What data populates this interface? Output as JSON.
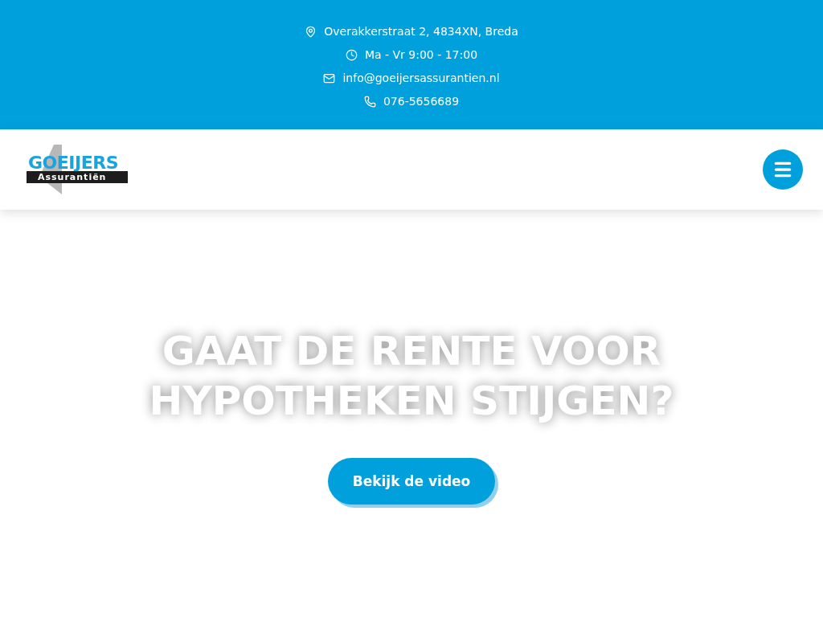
{
  "contact_bar": [
    {
      "kind": "location",
      "text": "Overakkerstraat 2, 4834XN, Breda"
    },
    {
      "kind": "clock",
      "text": "Ma - Vr 9:00 - 17:00"
    },
    {
      "kind": "mail",
      "text": "info@goeijersassurantien.nl"
    },
    {
      "kind": "phone",
      "text": "076-5656689"
    }
  ],
  "logo": {
    "top": "GOEIJERS",
    "bottom": "Assurantiën"
  },
  "hero": {
    "title": "GAAT DE RENTE VOOR HYPOTHEKEN STIJGEN?",
    "button": "Bekijk de video"
  }
}
